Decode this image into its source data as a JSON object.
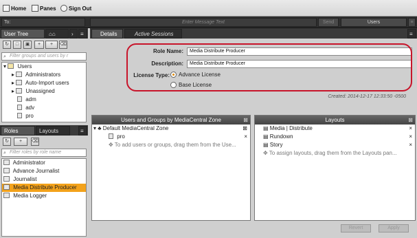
{
  "toolbar": {
    "home": "Home",
    "panes": "Panes",
    "sign_out": "Sign Out"
  },
  "message_bar": {
    "to_label": "To:",
    "message_placeholder": "Enter Message Text",
    "send": "Send",
    "users_select": "Users"
  },
  "user_tree_panel": {
    "tab_label": "User Tree",
    "filter_placeholder": "Filter groups and users by r",
    "items": [
      {
        "label": "Users",
        "level": 0,
        "type": "folder"
      },
      {
        "label": "Administrators",
        "level": 1,
        "type": "group"
      },
      {
        "label": "Auto-Import users",
        "level": 1,
        "type": "group"
      },
      {
        "label": "Unassigned",
        "level": 1,
        "type": "group"
      },
      {
        "label": "adm",
        "level": 1,
        "type": "user"
      },
      {
        "label": "adv",
        "level": 1,
        "type": "user"
      },
      {
        "label": "pro",
        "level": 1,
        "type": "user"
      }
    ]
  },
  "roles_panel": {
    "tab_roles": "Roles",
    "tab_layouts": "Layouts",
    "filter_placeholder": "Filter roles by role name",
    "items": [
      {
        "label": "Administrator",
        "selected": false
      },
      {
        "label": "Advance Journalist",
        "selected": false
      },
      {
        "label": "Journalist",
        "selected": false
      },
      {
        "label": "Media Distribute Producer",
        "selected": true
      },
      {
        "label": "Media Logger",
        "selected": false
      }
    ]
  },
  "details": {
    "tab_details": "Details",
    "tab_active_sessions": "Active Sessions",
    "role_name_label": "Role Name:",
    "role_name_value": "Media Distribute Producer",
    "description_label": "Description:",
    "description_value": "Media Distribute Producer",
    "license_type_label": "License Type:",
    "license_advance": "Advance License",
    "license_base": "Base License",
    "license_selected": "Advance License",
    "created": "Created:  2014-12-17 12:33:50 -0500"
  },
  "users_groups": {
    "title": "Users and Groups by MediaCentral Zone",
    "zone": "Default MediaCentral Zone",
    "users": [
      "pro"
    ],
    "hint": "To add users or groups, drag them from the Use..."
  },
  "layouts": {
    "title": "Layouts",
    "items": [
      "Media | Distribute",
      "Rundown",
      "Story"
    ],
    "hint": "To assign layouts, drag them from the Layouts pan..."
  },
  "footer_buttons": {
    "revert": "Revert",
    "apply": "Apply"
  },
  "colors": {
    "selection": "#f3a21b",
    "highlight_ring": "#c8142a"
  }
}
